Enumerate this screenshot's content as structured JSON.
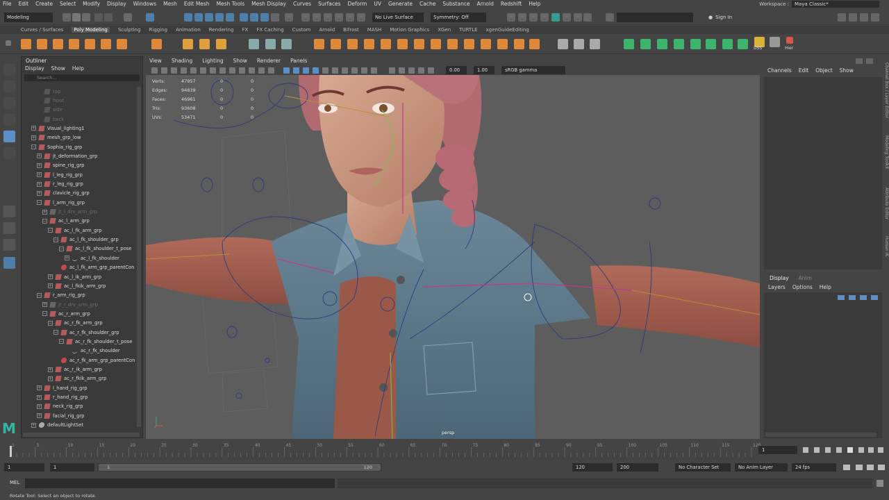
{
  "menubar": {
    "items": [
      "File",
      "Edit",
      "Create",
      "Select",
      "Modify",
      "Display",
      "Windows",
      "Mesh",
      "Edit Mesh",
      "Mesh Tools",
      "Mesh Display",
      "Curves",
      "Surfaces",
      "Deform",
      "UV",
      "Generate",
      "Cache",
      "Substance",
      "Arnold",
      "Redshift",
      "Help"
    ],
    "workspace_label": "Workspace :",
    "workspace_value": "Maya Classic*"
  },
  "statusline": {
    "mode": "Modeling",
    "live_surface": "No Live Surface",
    "symmetry": "Symmetry: Off",
    "sign_in": "Sign In"
  },
  "shelf": {
    "tabs": [
      "Curves / Surfaces",
      "Poly Modeling",
      "Sculpting",
      "Rigging",
      "Animation",
      "Rendering",
      "FX",
      "FX Caching",
      "Custom",
      "Arnold",
      "Bifrost",
      "MASH",
      "Motion Graphics",
      "XGen",
      "TURTLE",
      "xgenGuideEditing"
    ],
    "active_tab": "Poly Modeling",
    "label_dss": "DSS",
    "label_hier": "Hier"
  },
  "outliner": {
    "title": "Outliner",
    "menu": [
      "Display",
      "Show",
      "Help"
    ],
    "search_placeholder": "Search...",
    "rows": [
      {
        "label": "top",
        "indent": 2,
        "exp": false,
        "dim": true,
        "cam": true
      },
      {
        "label": "front",
        "indent": 2,
        "exp": false,
        "dim": true,
        "cam": true
      },
      {
        "label": "side",
        "indent": 2,
        "exp": false,
        "dim": true,
        "cam": true
      },
      {
        "label": "back",
        "indent": 2,
        "exp": false,
        "dim": true,
        "cam": true
      },
      {
        "label": "Visual_lighting1",
        "indent": 1,
        "exp": true,
        "dim": false
      },
      {
        "label": "mesh_grp_low",
        "indent": 1,
        "exp": true,
        "dim": false
      },
      {
        "label": "Sophia_rig_grp",
        "indent": 1,
        "exp": true,
        "open": true,
        "dim": false
      },
      {
        "label": "jt_deformation_grp",
        "indent": 2,
        "exp": true,
        "dim": false
      },
      {
        "label": "spine_rig_grp",
        "indent": 2,
        "exp": true,
        "dim": false
      },
      {
        "label": "l_leg_rig_grp",
        "indent": 2,
        "exp": true,
        "dim": false
      },
      {
        "label": "r_leg_rig_grp",
        "indent": 2,
        "exp": true,
        "dim": false
      },
      {
        "label": "clavicle_rig_grp",
        "indent": 2,
        "exp": true,
        "dim": false
      },
      {
        "label": "l_arm_rig_grp",
        "indent": 2,
        "exp": true,
        "open": true,
        "dim": false
      },
      {
        "label": "jt_l_drv_arm_grp",
        "indent": 3,
        "exp": true,
        "dim": true
      },
      {
        "label": "ac_l_arm_grp",
        "indent": 3,
        "exp": true,
        "open": true,
        "dim": false
      },
      {
        "label": "ac_l_fk_arm_grp",
        "indent": 4,
        "exp": true,
        "open": true,
        "dim": false
      },
      {
        "label": "ac_l_fk_shoulder_grp",
        "indent": 5,
        "exp": true,
        "open": true,
        "dim": false
      },
      {
        "label": "ac_l_fk_shoulder_t_pose",
        "indent": 6,
        "exp": true,
        "open": true,
        "dim": false
      },
      {
        "label": "ac_l_fk_shoulder",
        "indent": 7,
        "exp": true,
        "dim": false,
        "curve": true
      },
      {
        "label": "ac_l_fk_arm_grp_parentCon",
        "indent": 5,
        "exp": false,
        "dim": false,
        "con": true
      },
      {
        "label": "ac_l_ik_arm_grp",
        "indent": 4,
        "exp": true,
        "dim": false
      },
      {
        "label": "ac_l_fkik_arm_grp",
        "indent": 4,
        "exp": true,
        "dim": false
      },
      {
        "label": "r_arm_rig_grp",
        "indent": 2,
        "exp": true,
        "open": true,
        "dim": false
      },
      {
        "label": "jt_r_drv_arm_grp",
        "indent": 3,
        "exp": true,
        "dim": true
      },
      {
        "label": "ac_r_arm_grp",
        "indent": 3,
        "exp": true,
        "open": true,
        "dim": false
      },
      {
        "label": "ac_r_fk_arm_grp",
        "indent": 4,
        "exp": true,
        "open": true,
        "dim": false
      },
      {
        "label": "ac_r_fk_shoulder_grp",
        "indent": 5,
        "exp": true,
        "open": true,
        "dim": false
      },
      {
        "label": "ac_r_fk_shoulder_t_pose",
        "indent": 6,
        "exp": true,
        "open": true,
        "dim": false
      },
      {
        "label": "ac_r_fk_shoulder",
        "indent": 7,
        "exp": false,
        "dim": false,
        "curve": true
      },
      {
        "label": "ac_r_fk_arm_grp_parentCon",
        "indent": 5,
        "exp": false,
        "dim": false,
        "con": true
      },
      {
        "label": "ac_r_ik_arm_grp",
        "indent": 4,
        "exp": true,
        "dim": false
      },
      {
        "label": "ac_r_fkik_arm_grp",
        "indent": 4,
        "exp": true,
        "dim": false
      },
      {
        "label": "l_hand_rig_grp",
        "indent": 2,
        "exp": true,
        "dim": false
      },
      {
        "label": "r_hand_rig_grp",
        "indent": 2,
        "exp": true,
        "dim": false
      },
      {
        "label": "neck_rig_grp",
        "indent": 2,
        "exp": true,
        "dim": false
      },
      {
        "label": "facial_rig_grp",
        "indent": 2,
        "exp": true,
        "dim": false
      },
      {
        "label": "defaultLightSet",
        "indent": 1,
        "exp": true,
        "dim": false,
        "set": true
      }
    ]
  },
  "viewport": {
    "menu": [
      "View",
      "Shading",
      "Lighting",
      "Show",
      "Renderer",
      "Panels"
    ],
    "exposure": "0.00",
    "gamma": "1.00",
    "color_space": "sRGB gamma",
    "camera_label": "persp",
    "hud": [
      {
        "label": "Verts:",
        "v1": "47957",
        "v2": "0",
        "v3": "0"
      },
      {
        "label": "Edges:",
        "v1": "94839",
        "v2": "0",
        "v3": "0"
      },
      {
        "label": "Faces:",
        "v1": "46961",
        "v2": "0",
        "v3": "0"
      },
      {
        "label": "Tris:",
        "v1": "93608",
        "v2": "0",
        "v3": "0"
      },
      {
        "label": "UVs:",
        "v1": "53471",
        "v2": "0",
        "v3": "0"
      }
    ]
  },
  "channelbox": {
    "menu": [
      "Channels",
      "Edit",
      "Object",
      "Show"
    ]
  },
  "layers": {
    "tabs": [
      "Display",
      "Anim"
    ],
    "menu": [
      "Layers",
      "Options",
      "Help"
    ]
  },
  "sidetabs": [
    "Channel Box / Layer Editor",
    "Modeling Toolkit",
    "Attribute Editor",
    "Human IK"
  ],
  "timeline": {
    "ticks": [
      "1",
      "5",
      "10",
      "15",
      "20",
      "25",
      "30",
      "35",
      "40",
      "45",
      "50",
      "55",
      "60",
      "65",
      "70",
      "75",
      "80",
      "85",
      "90",
      "95",
      "100",
      "105",
      "110",
      "115",
      "120"
    ],
    "current_frame": "1"
  },
  "range": {
    "start": "1",
    "inner_start": "1",
    "slider_start": "1",
    "slider_end": "120",
    "end": "120",
    "outer_end": "200",
    "character_set": "No Character Set",
    "anim_layer": "No Anim Layer",
    "fps": "24 fps"
  },
  "cmd": {
    "lang": "MEL"
  },
  "helpline": "Rotate Tool: Select an object to rotate."
}
